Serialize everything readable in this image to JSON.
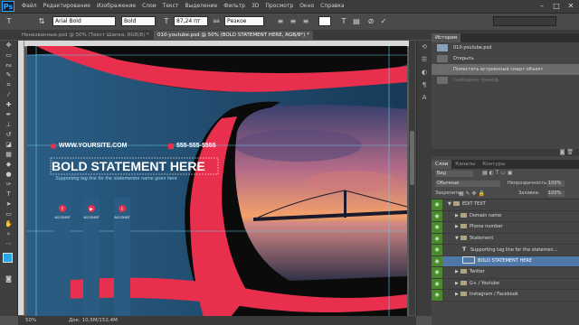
{
  "app": {
    "logo": "Ps"
  },
  "menu": [
    "Файл",
    "Редактирование",
    "Изображение",
    "Слои",
    "Текст",
    "Выделение",
    "Фильтр",
    "3D",
    "Просмотр",
    "Окно",
    "Справка"
  ],
  "options": {
    "font_family": "Arial Bold",
    "font_style": "Bold",
    "font_size": "87,24 пт",
    "antialias": "Резкое",
    "aa_prefix": "aa"
  },
  "tabs": [
    {
      "label": "Неназванные.psd @ 50% (Текст Шапка, RGB/8) *"
    },
    {
      "label": "010-youtube.psd @ 50% (BOLD STATEMENT HERE, RGB/8*) *",
      "active": true
    }
  ],
  "artwork": {
    "website": "WWW.YOURSITE.COM",
    "phone": "555-555-5555",
    "headline": "BOLD STATEMENT HERE",
    "tagline": "Supporting tag line for the statementor name goes here",
    "buttons": [
      "ACCOUNT",
      "ACCOUNT",
      "ACCOUNT"
    ],
    "colors": {
      "primary_red": "#e8304e",
      "bg_blue": "#1f4c6e",
      "text_white": "#ffffff"
    }
  },
  "status": {
    "zoom": "50%",
    "doc": "Док: 10,5M/152,4M"
  },
  "history": {
    "tabs": [
      "История"
    ],
    "doc": "010-youtube.psd",
    "items": [
      {
        "label": "Открыть",
        "state": "normal"
      },
      {
        "label": "Поместить встроенный смарт-объект",
        "state": "active"
      },
      {
        "label": "Свободное трансф.",
        "state": "dim"
      }
    ]
  },
  "layers_panel": {
    "tabs": [
      "Слои",
      "Каналы",
      "Контуры"
    ],
    "filter": "Вид",
    "blend_mode": "Обычные",
    "opacity_label": "Непрозрачность:",
    "opacity": "100%",
    "lock_label": "Закрепить:",
    "fill_label": "Заливка:",
    "fill": "100%",
    "layers": [
      {
        "name": "EDIT TEXT",
        "type": "group",
        "indent": 0,
        "open": true
      },
      {
        "name": "Domain name",
        "type": "group",
        "indent": 1,
        "open": false
      },
      {
        "name": "Phone number",
        "type": "group",
        "indent": 1,
        "open": false
      },
      {
        "name": "Statement",
        "type": "group",
        "indent": 1,
        "open": true
      },
      {
        "name": "Supporting tag line for the statemen...",
        "type": "text",
        "indent": 2
      },
      {
        "name": "BOLD STATEMENT HERE",
        "type": "text-active",
        "indent": 2,
        "active": true
      },
      {
        "name": "Twitter",
        "type": "group",
        "indent": 1,
        "open": false
      },
      {
        "name": "G+ / Youtube",
        "type": "group",
        "indent": 1,
        "open": false
      },
      {
        "name": "Instagram / Facebook",
        "type": "group",
        "indent": 1,
        "open": false
      }
    ]
  }
}
